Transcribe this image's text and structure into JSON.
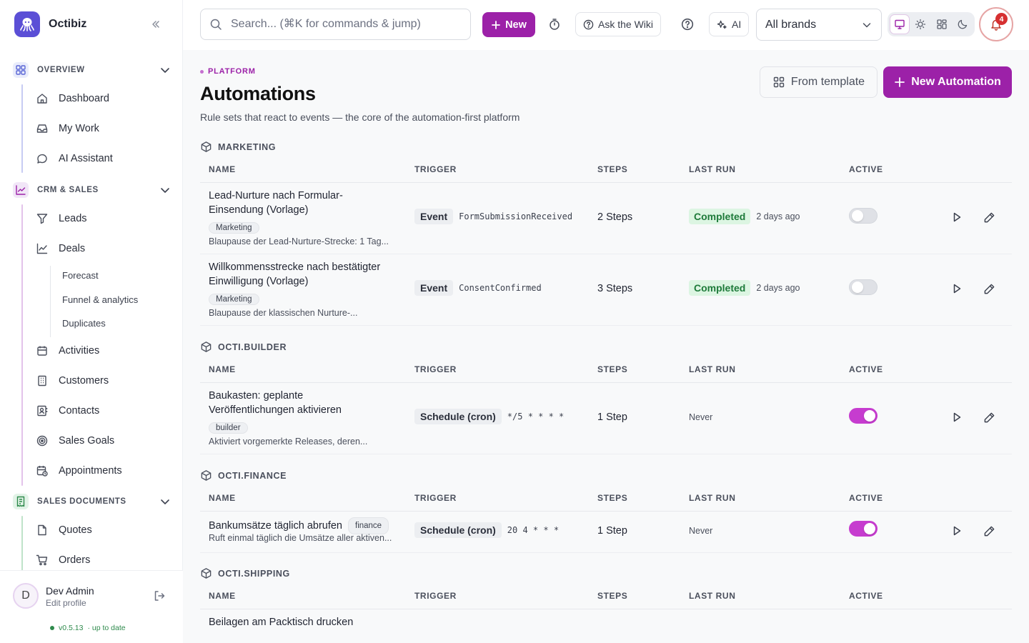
{
  "app": {
    "name": "Octibiz"
  },
  "topbar": {
    "search_placeholder": "Search... (⌘K for commands & jump)",
    "new_label": "New",
    "wiki_label": "Ask the Wiki",
    "ai_label": "AI",
    "brand_select": "All brands",
    "notification_count": "4"
  },
  "sidebar": {
    "sections": [
      {
        "label": "OVERVIEW",
        "items": [
          "Dashboard",
          "My Work",
          "AI Assistant"
        ]
      },
      {
        "label": "CRM & SALES",
        "items": [
          "Leads",
          "Deals",
          "Activities",
          "Customers",
          "Contacts",
          "Sales Goals",
          "Appointments"
        ],
        "deals_sub": [
          "Forecast",
          "Funnel & analytics",
          "Duplicates"
        ]
      },
      {
        "label": "SALES DOCUMENTS",
        "items": [
          "Quotes",
          "Orders"
        ]
      }
    ],
    "user": {
      "name": "Dev Admin",
      "sub": "Edit profile",
      "initial": "D"
    },
    "version": "v0.5.13",
    "version_status": "· up to date"
  },
  "page": {
    "eyebrow": "PLATFORM",
    "title": "Automations",
    "subtitle": "Rule sets that react to events — the core of the automation-first platform",
    "from_template": "From template",
    "new_automation": "New Automation"
  },
  "columns": {
    "name": "NAME",
    "trigger": "TRIGGER",
    "steps": "STEPS",
    "last_run": "LAST RUN",
    "active": "ACTIVE"
  },
  "groups": [
    {
      "title": "MARKETING",
      "rows": [
        {
          "name": "Lead-Nurture nach Formular-Einsendung (Vorlage)",
          "tag": "Marketing",
          "desc": "Blaupause der Lead-Nurture-Strecke: 1 Tag...",
          "trigger_type": "Event",
          "trigger_value": "FormSubmissionReceived",
          "steps": "2 Steps",
          "status": "Completed",
          "ago": "2 days ago",
          "active": false
        },
        {
          "name": "Willkommensstrecke nach bestätigter Einwilligung (Vorlage)",
          "tag": "Marketing",
          "desc": "Blaupause der klassischen Nurture-...",
          "trigger_type": "Event",
          "trigger_value": "ConsentConfirmed",
          "steps": "3 Steps",
          "status": "Completed",
          "ago": "2 days ago",
          "active": false
        }
      ]
    },
    {
      "title": "OCTI.BUILDER",
      "rows": [
        {
          "name": "Baukasten: geplante Veröffentlichungen aktivieren",
          "tag": "builder",
          "desc": "Aktiviert vorgemerkte Releases, deren...",
          "trigger_type": "Schedule (cron)",
          "trigger_value": "*/5 * * * *",
          "steps": "1 Step",
          "never": "Never",
          "active": true
        }
      ]
    },
    {
      "title": "OCTI.FINANCE",
      "rows": [
        {
          "name": "Bankumsätze täglich abrufen",
          "tag": "finance",
          "desc": "Ruft einmal täglich die Umsätze aller aktiven...",
          "trigger_type": "Schedule (cron)",
          "trigger_value": "20 4 * * *",
          "steps": "1 Step",
          "never": "Never",
          "active": true
        }
      ]
    },
    {
      "title": "OCTI.SHIPPING",
      "rows": [
        {
          "name": "Beilagen am Packtisch drucken"
        }
      ]
    }
  ],
  "colors": {
    "accent": "#9c21a8",
    "toggle_on": "#c63ccf",
    "success_bg": "#dcf5e2",
    "success_text": "#1e7a3a"
  }
}
